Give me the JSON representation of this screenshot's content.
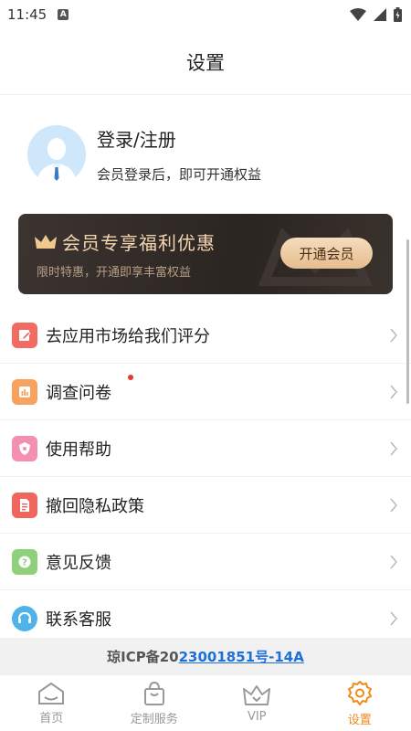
{
  "status_bar": {
    "time": "11:45",
    "badge": "A"
  },
  "header": {
    "title": "设置"
  },
  "user": {
    "name": "登录/注册",
    "subtitle": "会员登录后，即可开通权益"
  },
  "vip_banner": {
    "title": "会员专享福利优惠",
    "subtitle": "限时特惠，开通即享丰富权益",
    "button": "开通会员"
  },
  "menu": {
    "items": [
      {
        "label": "去应用市场给我们评分",
        "icon": "edit-icon",
        "color": "#f26b62"
      },
      {
        "label": "调查问卷",
        "icon": "chart-icon",
        "color": "#f7a25f",
        "badge_dot": true
      },
      {
        "label": "使用帮助",
        "icon": "shield-icon",
        "color": "#f48fb0"
      },
      {
        "label": "撤回隐私政策",
        "icon": "document-icon",
        "color": "#f0665e"
      },
      {
        "label": "意见反馈",
        "icon": "question-icon",
        "color": "#8fd07a"
      },
      {
        "label": "联系客服",
        "icon": "headset-icon",
        "color": "#4fb3ea"
      }
    ]
  },
  "icp": {
    "prefix": "琼ICP备20",
    "link": "23001851号-14A"
  },
  "tabbar": {
    "items": [
      {
        "label": "首页",
        "icon": "home-icon"
      },
      {
        "label": "定制服务",
        "icon": "shopping-bag-icon"
      },
      {
        "label": "VIP",
        "icon": "crown-icon"
      },
      {
        "label": "设置",
        "icon": "gear-icon",
        "active": true
      }
    ]
  },
  "colors": {
    "accent": "#f08a1c",
    "link": "#1e6fd9",
    "vip_gold": "#f3d5b0"
  }
}
